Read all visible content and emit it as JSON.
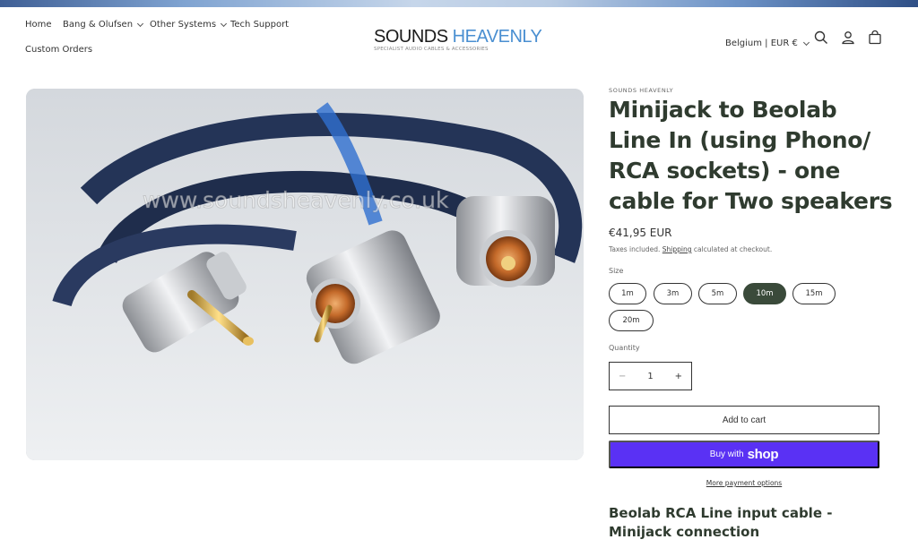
{
  "header": {
    "nav": [
      {
        "label": "Home",
        "has_dropdown": false
      },
      {
        "label": "Bang & Olufsen",
        "has_dropdown": true
      },
      {
        "label": "Other Systems",
        "has_dropdown": true
      },
      {
        "label": "Tech Support",
        "has_dropdown": false
      },
      {
        "label": "Custom Orders",
        "has_dropdown": false
      }
    ],
    "logo_part1": "SOUNDS",
    "logo_part2": "HEAVENLY",
    "logo_tagline": "SPECIALIST AUDIO CABLES & ACCESSORIES",
    "locale": "Belgium | EUR €",
    "icons": [
      "search-icon",
      "account-icon",
      "cart-icon"
    ]
  },
  "product": {
    "image_watermark": "www.soundsheavenly.co.uk",
    "vendor": "SOUNDS HEAVENLY",
    "title": "Minijack to Beolab Line In (using Phono/ RCA sockets) - one cable for Two speakers",
    "price": "€41,95 EUR",
    "tax_prefix": "Taxes included.",
    "tax_link": "Shipping",
    "tax_suffix": "calculated at checkout.",
    "size_label": "Size",
    "sizes": [
      "1m",
      "3m",
      "5m",
      "10m",
      "15m",
      "20m"
    ],
    "selected_size": "10m",
    "quantity_label": "Quantity",
    "quantity": "1",
    "qty_minus": "−",
    "qty_plus": "+",
    "add_to_cart": "Add to cart",
    "buy_with": "Buy with",
    "buy_with_brand": "shop",
    "more_payment": "More payment options",
    "description_heading": "Beolab RCA Line input cable - Minijack connection"
  },
  "colors": {
    "accent_dark": "#3a4a3a",
    "shop_pay": "#5a31f4",
    "logo_blue": "#4a8fd1"
  }
}
